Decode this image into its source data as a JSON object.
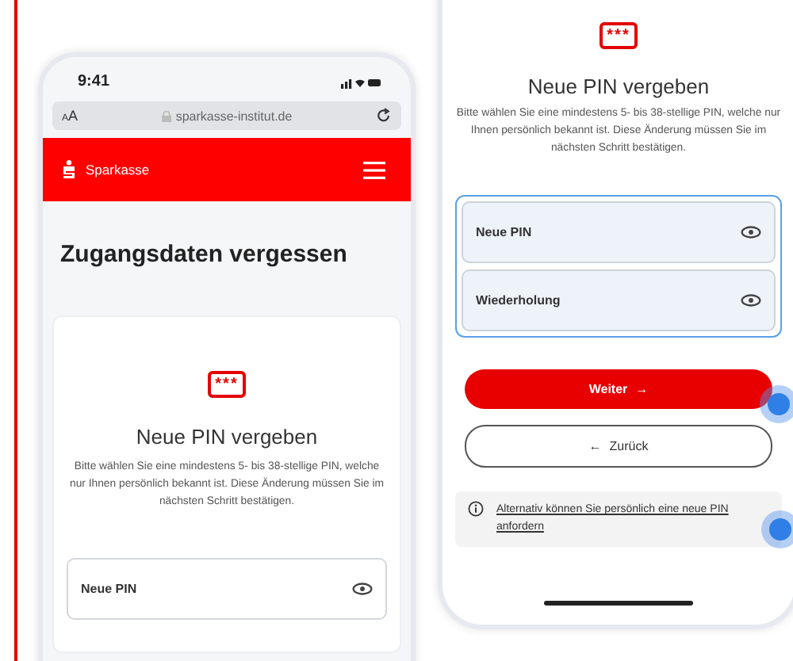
{
  "left_phone": {
    "status_time": "9:41",
    "address_bar": {
      "text_size": "AA",
      "url": "sparkasse-institut.de"
    },
    "header": {
      "brand": "Sparkasse"
    },
    "heading": "Zugangsdaten vergessen",
    "card": {
      "badge": "***",
      "title": "Neue PIN vergeben",
      "description": "Bitte wählen Sie eine mindestens 5- bis 38-stellige PIN, welche nur Ihnen persönlich bekannt ist. Diese Änderung müssen Sie im nächsten Schritt bestätigen.",
      "fields": [
        {
          "placeholder": "Neue PIN"
        }
      ]
    }
  },
  "right_phone": {
    "badge": "***",
    "title": "Neue PIN vergeben",
    "description": "Bitte wählen Sie eine mindestens 5- bis 38-stellige PIN, welche nur Ihnen persönlich bekannt ist. Diese Änderung müssen Sie im nächsten Schritt bestätigen.",
    "field_group_focused": true,
    "fields": [
      {
        "placeholder": "Neue PIN"
      },
      {
        "placeholder": "Wiederholung"
      }
    ],
    "buttons": [
      {
        "kind": "primary",
        "label": "Weiter",
        "arrow": "→"
      },
      {
        "kind": "secondary",
        "label": "Zurück",
        "arrow": "←"
      }
    ],
    "info": {
      "link": "Alternativ können Sie persönlich eine neue PIN anfordern"
    }
  }
}
